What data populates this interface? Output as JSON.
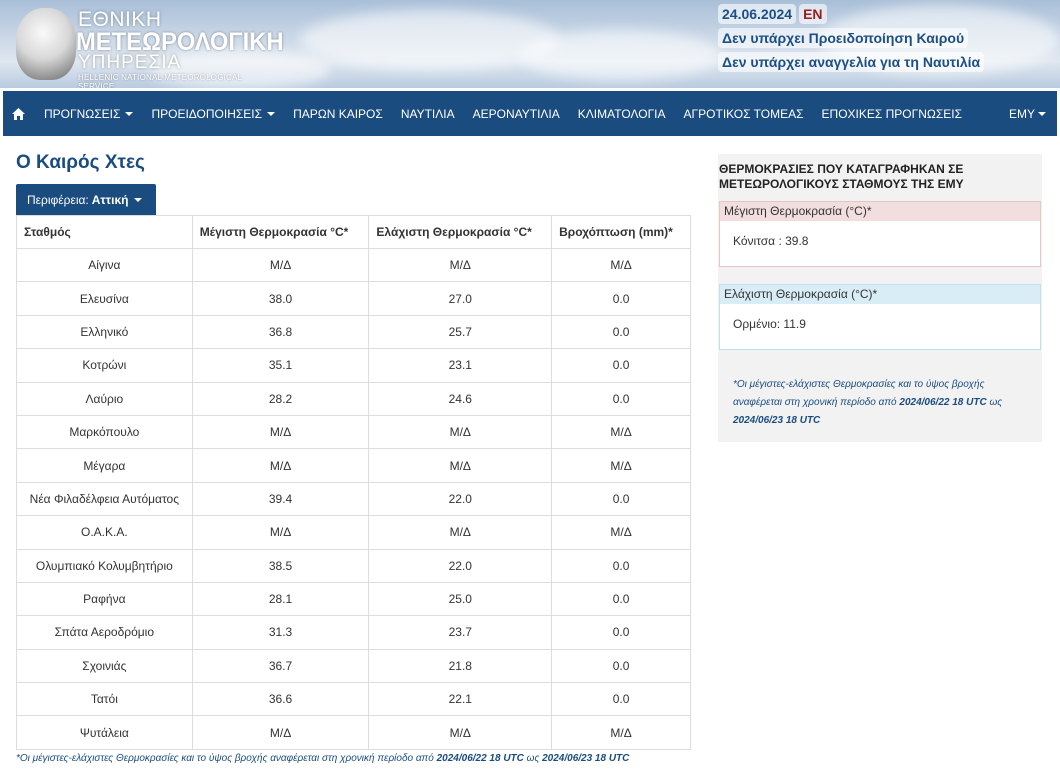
{
  "header": {
    "logo": {
      "line1": "ΕΘΝΙΚΗ",
      "line2": "ΜΕΤΕΩΡΟΛΟΓΙΚΗ",
      "line3": "ΥΠΗΡΕΣΙΑ",
      "line4": "HELLENIC NATIONAL METEOROLOGICAL SERVICE"
    },
    "date": "24.06.2024",
    "lang": "EN",
    "warning": "Δεν υπάρχει Προειδοποίηση Καιρού",
    "navtex": "Δεν υπάρχει αναγγελία για τη Ναυτιλία"
  },
  "nav": {
    "home_icon": "home-icon",
    "items": [
      {
        "label": "ΠΡΟΓΝΩΣΕΙΣ",
        "dropdown": true
      },
      {
        "label": "ΠΡΟΕΙΔΟΠΟΙΗΣΕΙΣ",
        "dropdown": true
      },
      {
        "label": "ΠΑΡΩΝ ΚΑΙΡΟΣ",
        "dropdown": false
      },
      {
        "label": "ΝΑΥΤΙΛΙΑ",
        "dropdown": false
      },
      {
        "label": "ΑΕΡΟΝΑΥΤΙΛΙΑ",
        "dropdown": false
      },
      {
        "label": "ΚΛΙΜΑΤΟΛΟΓΙΑ",
        "dropdown": false
      },
      {
        "label": "ΑΓΡΟΤΙΚΟΣ ΤΟΜΕΑΣ",
        "dropdown": false
      },
      {
        "label": "ΕΠΟΧΙΚΕΣ ΠΡΟΓΝΩΣΕΙΣ",
        "dropdown": false
      }
    ],
    "right_label": "ΕΜΥ"
  },
  "main": {
    "title": "Ο Καιρός Χτες",
    "region_prefix": "Περιφέρεια:",
    "region_value": "Αττική",
    "table": {
      "headers": [
        "Σταθμός",
        "Μέγιστη Θερμοκρασία °C*",
        "Ελάχιστη Θερμοκρασία °C*",
        "Βροχόπτωση (mm)*"
      ],
      "rows": [
        [
          "Αίγινα",
          "Μ/Δ",
          "Μ/Δ",
          "Μ/Δ"
        ],
        [
          "Ελευσίνα",
          "38.0",
          "27.0",
          "0.0"
        ],
        [
          "Ελληνικό",
          "36.8",
          "25.7",
          "0.0"
        ],
        [
          "Κοτρώνι",
          "35.1",
          "23.1",
          "0.0"
        ],
        [
          "Λαύριο",
          "28.2",
          "24.6",
          "0.0"
        ],
        [
          "Μαρκόπουλο",
          "Μ/Δ",
          "Μ/Δ",
          "Μ/Δ"
        ],
        [
          "Μέγαρα",
          "Μ/Δ",
          "Μ/Δ",
          "Μ/Δ"
        ],
        [
          "Νέα Φιλαδέλφεια Αυτόματος",
          "39.4",
          "22.0",
          "0.0"
        ],
        [
          "Ο.Α.Κ.Α.",
          "Μ/Δ",
          "Μ/Δ",
          "Μ/Δ"
        ],
        [
          "Ολυμπιακό Κολυμβητήριο",
          "38.5",
          "22.0",
          "0.0"
        ],
        [
          "Ραφήνα",
          "28.1",
          "25.0",
          "0.0"
        ],
        [
          "Σπάτα Αεροδρόμιο",
          "31.3",
          "23.7",
          "0.0"
        ],
        [
          "Σχοινιάς",
          "36.7",
          "21.8",
          "0.0"
        ],
        [
          "Τατόι",
          "36.6",
          "22.1",
          "0.0"
        ],
        [
          "Ψυτάλεια",
          "Μ/Δ",
          "Μ/Δ",
          "Μ/Δ"
        ]
      ]
    },
    "footnote": {
      "text": "*Οι μέγιστες-ελάχιστες Θερμοκρασίες και το ύψος βροχής αναφέρεται στη χρονική περίοδο από",
      "from": "2024/06/22 18 UTC",
      "mid": "ως",
      "to": "2024/06/23 18 UTC"
    }
  },
  "side": {
    "title": "ΘΕΡΜΟΚΡΑΣΙΕΣ ΠΟΥ ΚΑΤΑΓΡΑΦΗΚΑΝ ΣΕ ΜΕΤΕΩΡΟΛΟΓΙΚΟΥΣ ΣΤΑΘΜΟΥΣ ΤΗΣ ΕΜΥ",
    "max_head": "Μέγιστη Θερμοκρασία (°C)*",
    "max_value": "Κόνιτσα : 39.8",
    "min_head": "Ελάχιστη Θερμοκρασία (°C)*",
    "min_value": "Ορμένιο: 11.9",
    "note": {
      "text": "*Οι μέγιστες-ελάχιστες Θερμοκρασίες και το ύψος βροχής αναφέρεται στη χρονική περίοδο από",
      "from": "2024/06/22 18 UTC",
      "mid": "ως",
      "to": "2024/06/23 18 UTC"
    }
  }
}
